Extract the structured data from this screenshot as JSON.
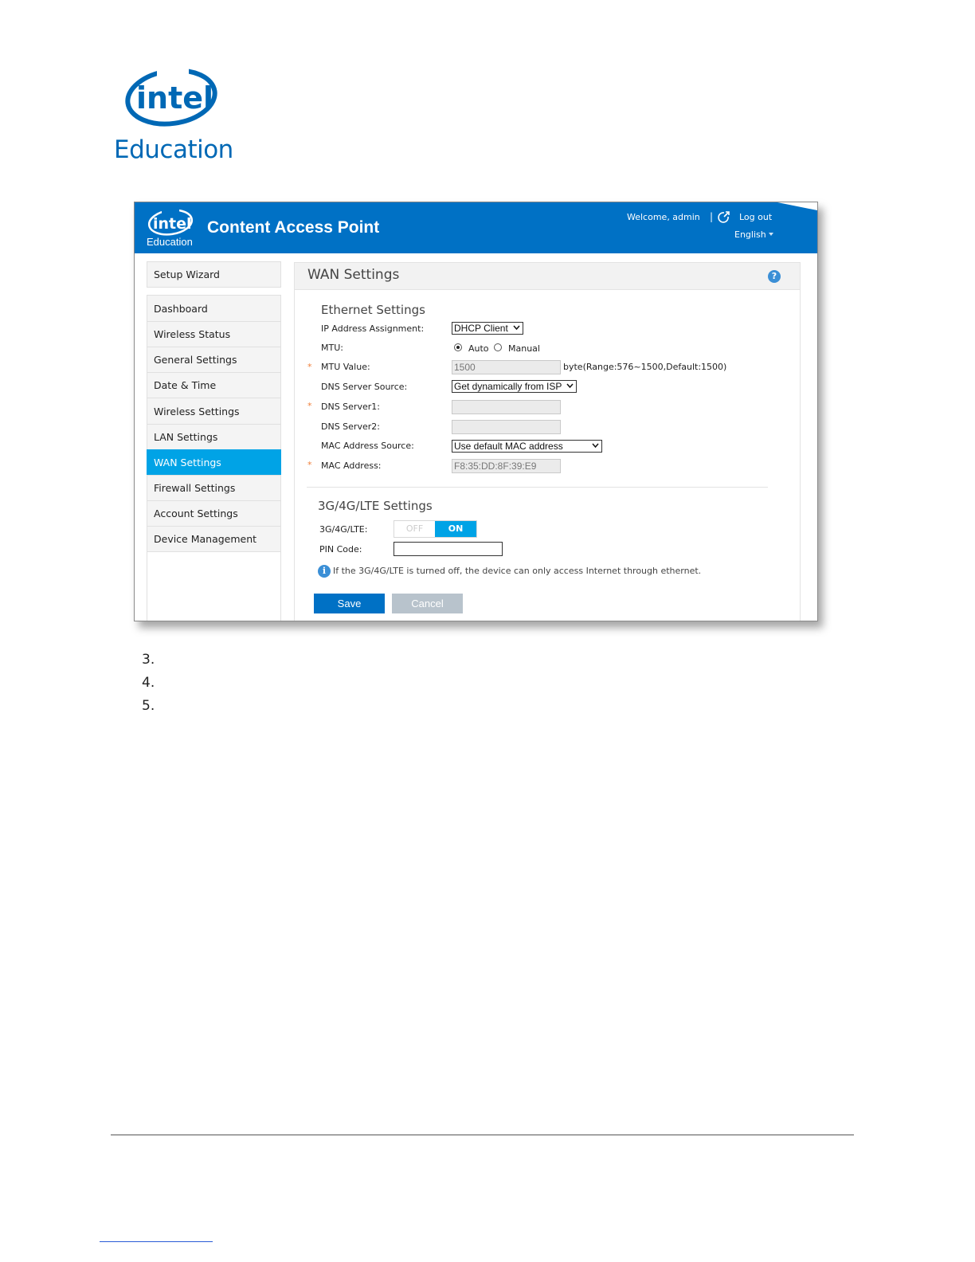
{
  "doc_logo": {
    "brand": "intel",
    "subtitle": "Education"
  },
  "app": {
    "logo_brand": "intel",
    "logo_subtitle": "Education",
    "title": "Content Access Point",
    "welcome": "Welcome, admin",
    "separator": "|",
    "logout": "Log out",
    "language": "English"
  },
  "sidebar": {
    "items": [
      {
        "label": "Setup Wizard"
      },
      {
        "label": "Dashboard"
      },
      {
        "label": "Wireless Status"
      },
      {
        "label": "General Settings"
      },
      {
        "label": "Date & Time"
      },
      {
        "label": "Wireless Settings"
      },
      {
        "label": "LAN Settings"
      },
      {
        "label": "WAN Settings",
        "active": true
      },
      {
        "label": "Firewall Settings"
      },
      {
        "label": "Account Settings"
      },
      {
        "label": "Device Management"
      }
    ]
  },
  "main": {
    "title": "WAN Settings",
    "help": "?",
    "ethernet": {
      "title": "Ethernet Settings",
      "ip_label": "IP Address Assignment:",
      "ip_value": "DHCP Client",
      "mtu_label": "MTU:",
      "mtu_auto": "Auto",
      "mtu_manual": "Manual",
      "mtu_value_label": "MTU Value:",
      "mtu_value": "1500",
      "mtu_hint": "byte(Range:576~1500,Default:1500)",
      "dns_source_label": "DNS Server Source:",
      "dns_source_value": "Get dynamically from ISP",
      "dns1_label": "DNS Server1:",
      "dns2_label": "DNS Server2:",
      "mac_source_label": "MAC Address Source:",
      "mac_source_value": "Use default MAC address",
      "mac_label": "MAC Address:",
      "mac_value": "F8:35:DD:8F:39:E9",
      "required_mark": "*"
    },
    "lte": {
      "title": "3G/4G/LTE Settings",
      "toggle_label": "3G/4G/LTE:",
      "toggle_off": "OFF",
      "toggle_on": "ON",
      "pin_label": "PIN Code:",
      "info_icon": "i",
      "info": "If the 3G/4G/LTE is turned off, the device can only access Internet through ethernet."
    },
    "save": "Save",
    "cancel": "Cancel"
  },
  "doc_list": [
    "3.",
    "4.",
    "5."
  ]
}
